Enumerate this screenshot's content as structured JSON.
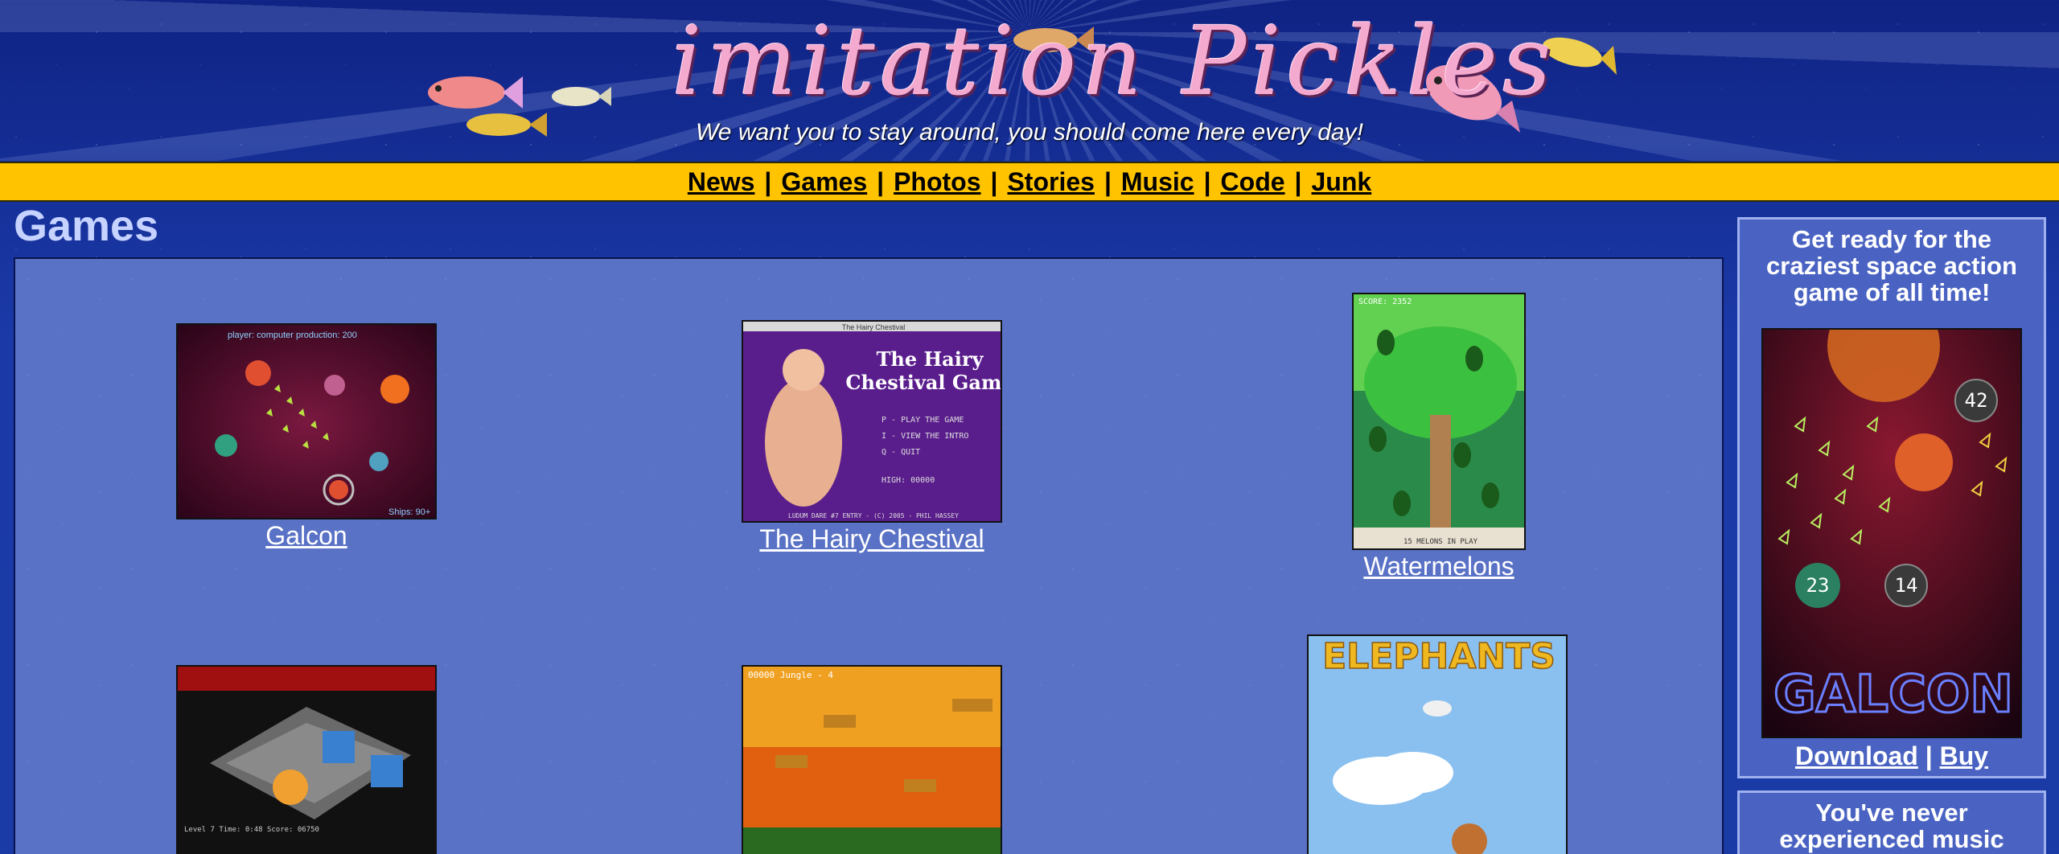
{
  "header": {
    "logo_text": "imitation Pickles",
    "tagline": "We want you to stay around, you should come here every day!"
  },
  "nav": {
    "items": [
      "News",
      "Games",
      "Photos",
      "Stories",
      "Music",
      "Code",
      "Junk"
    ],
    "separator": "|"
  },
  "page_title": "Games",
  "games": [
    {
      "title": "Galcon",
      "thumb_text": "player: computer   production: 200   Ships: 90+"
    },
    {
      "title": "The Hairy Chestival",
      "thumb_text": "The Hairy Chestival Game",
      "menu": [
        "P - PLAY THE GAME",
        "I - VIEW THE INTRO",
        "Q - QUIT",
        "HIGH: 00000"
      ],
      "footer": "LUDUM DARE #7 ENTRY - (C) 2005 - PHIL HASSEY",
      "window_title": "The Hairy Chestival"
    },
    {
      "title": "Watermelons",
      "thumb_text": "SCORE: 2352",
      "caption": "15 MELONS IN PLAY"
    },
    {
      "title": "",
      "thumb_text": "Level 7  Time: 0:48  Score: 06750"
    },
    {
      "title": "",
      "thumb_text": "00000   Jungle - 4"
    },
    {
      "title": "",
      "thumb_text": "ELEPHANTS"
    }
  ],
  "sidebar": {
    "promo1": {
      "headline": "Get ready for the craziest space action game of all time!",
      "numbers": [
        "42",
        "23",
        "14"
      ],
      "logo_text": "GALCON",
      "download_label": "Download",
      "buy_label": "Buy",
      "separator": "|"
    },
    "promo2": {
      "headline": "You've never experienced music"
    }
  },
  "colors": {
    "nav_bar": "#ffc300",
    "page_bg": "#12268e",
    "panel_bg": "#5a72c6",
    "logo_pink": "#f4a9cf",
    "title_text": "#c6d2ff"
  }
}
